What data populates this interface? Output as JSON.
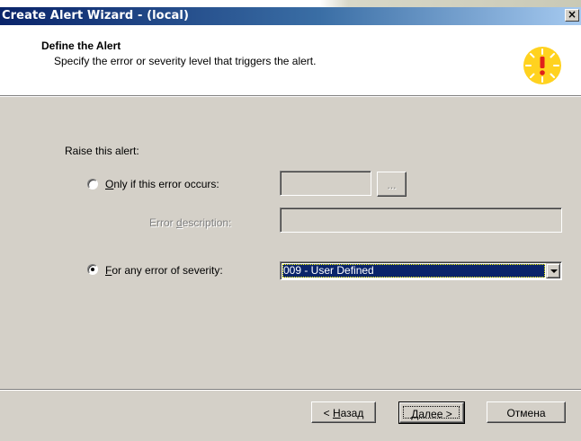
{
  "window": {
    "title": "Create Alert Wizard - (local)",
    "close_label": "×"
  },
  "header": {
    "title": "Define the Alert",
    "subtitle": "Specify the error or severity level that triggers the alert."
  },
  "form": {
    "raise_label": "Raise this alert:",
    "only_if": {
      "label_accel": "O",
      "label_rest": "nly if this error occurs:",
      "selected": false,
      "error_number_value": "",
      "browse_label": "..."
    },
    "error_description": {
      "label_pre": "Error ",
      "label_accel": "d",
      "label_rest": "escription:",
      "value": ""
    },
    "any_severity": {
      "label_accel": "F",
      "label_rest": "or any error of severity:",
      "selected": true,
      "severity_value": "009 - User Defined"
    }
  },
  "buttons": {
    "back": {
      "pre": "< ",
      "accel": "Н",
      "rest": "азад"
    },
    "next": {
      "accel": "Д",
      "rest": "алее >"
    },
    "cancel": "Отмена"
  },
  "colors": {
    "titlebar_start": "#0a246a",
    "titlebar_end": "#a6caf0",
    "face": "#d4d0c8",
    "selection": "#0a246a"
  },
  "icons": {
    "alert": "exclamation-sun-icon",
    "close": "close-icon",
    "dropdown": "chevron-down-icon"
  }
}
